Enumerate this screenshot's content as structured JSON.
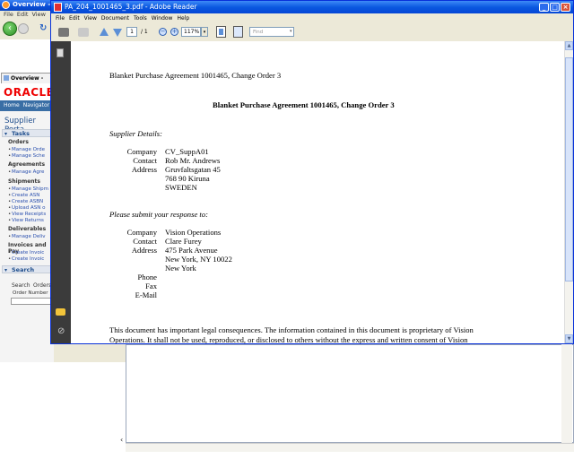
{
  "background_window": {
    "title": "Overview - Supp",
    "menu": [
      "File",
      "Edit",
      "View"
    ],
    "tab_label": "Overview - Su",
    "oracle_logo": "ORACLE",
    "nav": [
      "Home",
      "Navigator ▾"
    ],
    "portal_title": "Supplier Porta",
    "tasks_header": "Tasks",
    "categories": {
      "orders": "Orders",
      "agreements": "Agreements",
      "shipments": "Shipments",
      "deliverables": "Deliverables",
      "invoices": "Invoices and Pay"
    },
    "links": {
      "manage_orders": "Manage Orde",
      "manage_schedules": "Manage Sche",
      "manage_agreements": "Manage Agre",
      "manage_shipments": "Manage Shipm",
      "create_asn": "Create ASN",
      "create_asbn": "Create ASBN",
      "upload_asn": "Upload ASN o",
      "view_receipts": "View Receipts",
      "view_returns": "View Returns",
      "manage_deliverables": "Manage Deliv",
      "create_invoice_1": "Create Invoic",
      "create_invoice_2": "Create Invoic"
    },
    "search_header": "Search",
    "search_tabs": [
      "Search",
      "Orders"
    ],
    "order_number_label": "Order Number"
  },
  "reader": {
    "title": "PA_204_1001465_3.pdf - Adobe Reader",
    "menu": [
      "File",
      "Edit",
      "View",
      "Document",
      "Tools",
      "Window",
      "Help"
    ],
    "page_number": "1",
    "page_total": "/ 1",
    "zoom": "117%",
    "find_placeholder": "Find"
  },
  "document": {
    "header_line": "Blanket Purchase Agreement 1001465, Change Order 3",
    "title": "Blanket Purchase Agreement 1001465, Change Order 3",
    "supplier_heading": "Supplier Details:",
    "supplier": {
      "company_label": "Company",
      "company": "CV_SuppA01",
      "contact_label": "Contact",
      "contact": "Rob Mr. Andrews",
      "address_label": "Address",
      "address_lines": [
        "Gruvfaltsgatan 45",
        "768 90 Kiruna",
        "SWEDEN"
      ]
    },
    "response_heading": "Please submit your response to:",
    "response": {
      "company_label": "Company",
      "company": "Vision Operations",
      "contact_label": "Contact",
      "contact": "Clare Furey",
      "address_label": "Address",
      "address_lines": [
        "475 Park Avenue",
        "New York, NY  10022",
        "New York"
      ],
      "phone_label": "Phone",
      "fax_label": "Fax",
      "email_label": "E-Mail"
    },
    "legal_lines": [
      "This document has important legal consequences. The information contained in this document is proprietary of Vision",
      "Operations. It shall not be used, reproduced, or disclosed to others without the express and written consent of Vision"
    ]
  }
}
